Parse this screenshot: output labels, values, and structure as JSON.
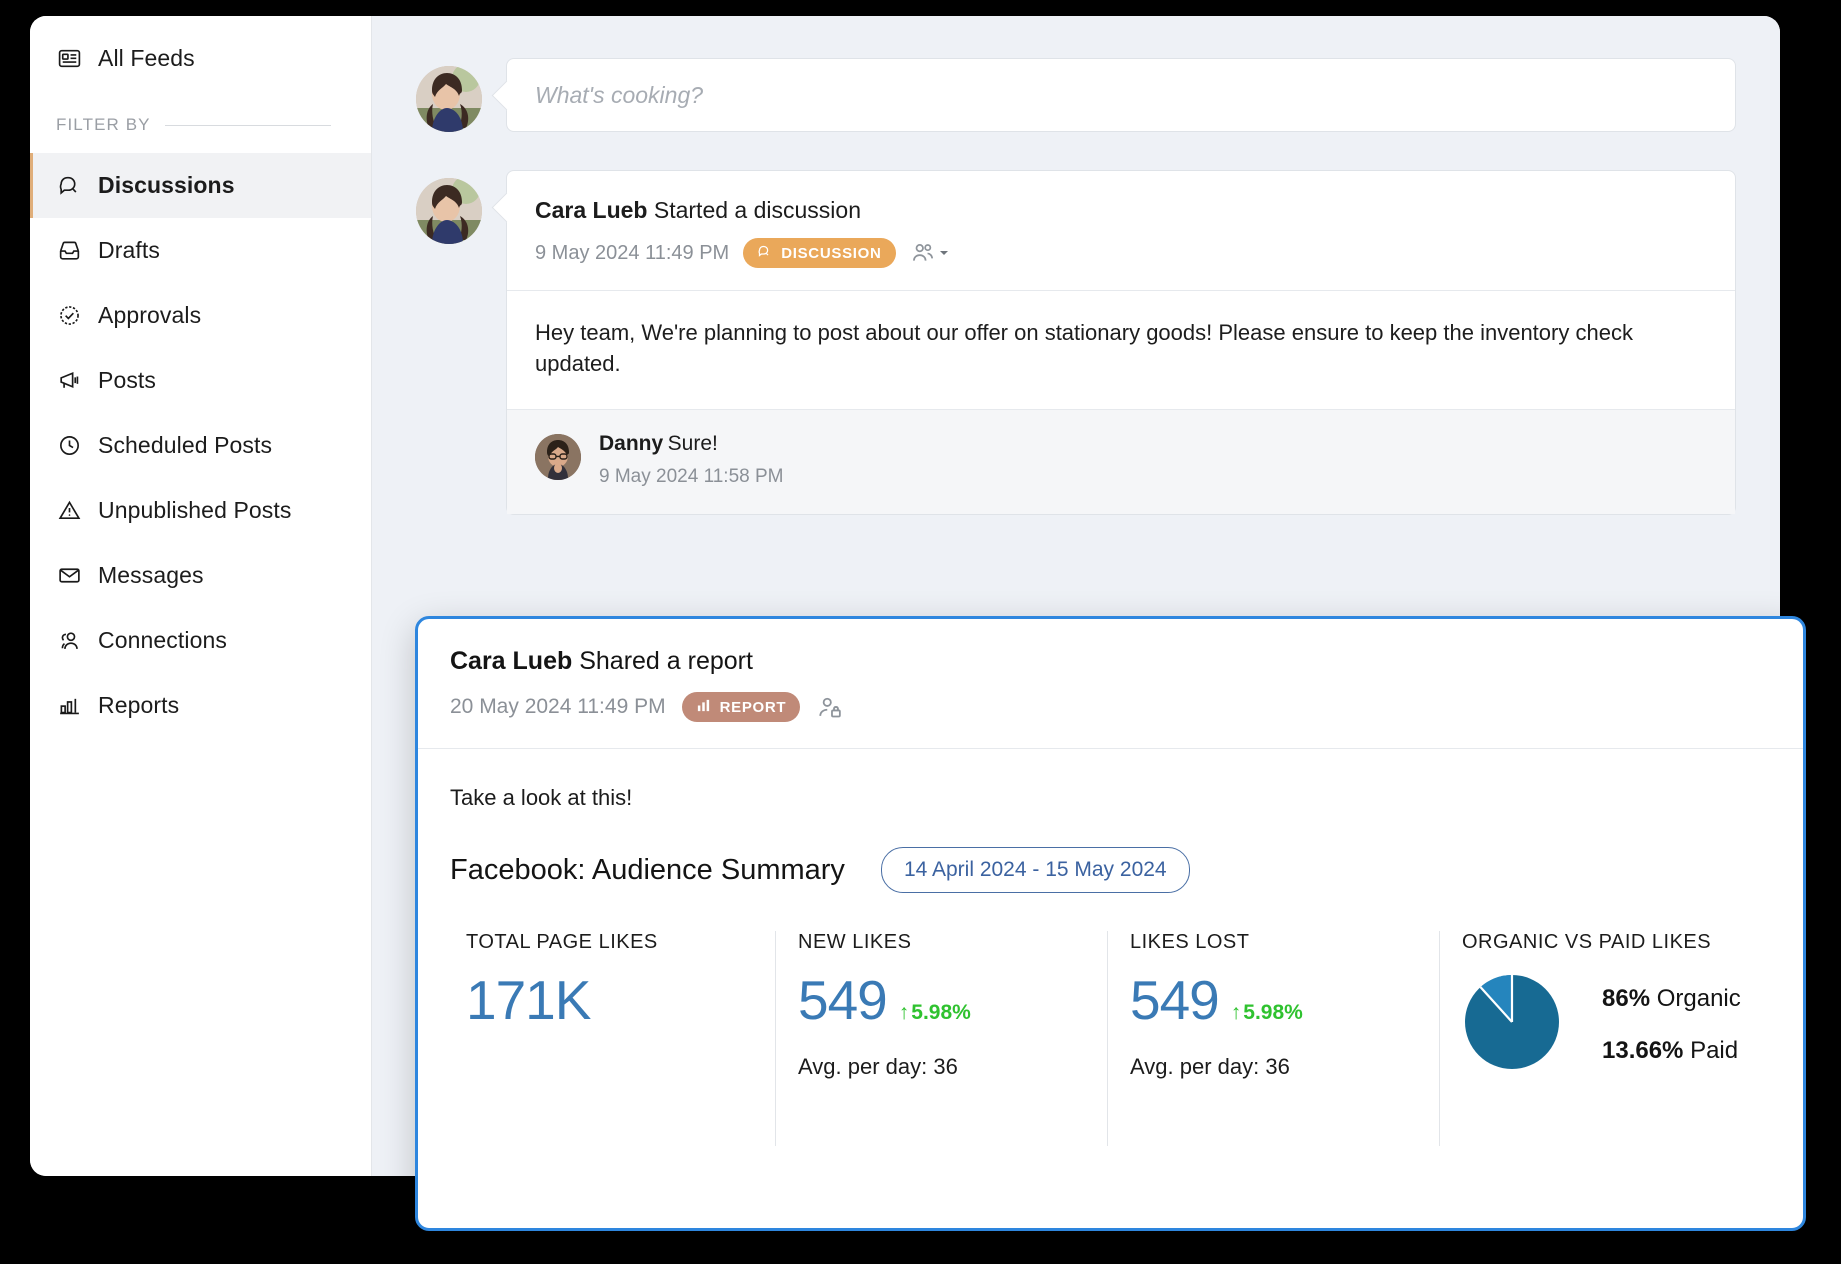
{
  "sidebar": {
    "top_item": {
      "label": "All Feeds",
      "icon": "feed-icon"
    },
    "filter_label": "FILTER BY",
    "items": [
      {
        "label": "Discussions",
        "icon": "chat-icon",
        "active": true
      },
      {
        "label": "Drafts",
        "icon": "drafts-tray-icon",
        "active": false
      },
      {
        "label": "Approvals",
        "icon": "check-badge-icon",
        "active": false
      },
      {
        "label": "Posts",
        "icon": "megaphone-icon",
        "active": false
      },
      {
        "label": "Scheduled Posts",
        "icon": "clock-icon",
        "active": false
      },
      {
        "label": "Unpublished Posts",
        "icon": "warning-triangle-icon",
        "active": false
      },
      {
        "label": "Messages",
        "icon": "envelope-icon",
        "active": false
      },
      {
        "label": "Connections",
        "icon": "people-icon",
        "active": false
      },
      {
        "label": "Reports",
        "icon": "bar-chart-icon",
        "active": false
      }
    ]
  },
  "composer": {
    "placeholder": "What's cooking?"
  },
  "discussion_post": {
    "author": "Cara Lueb",
    "action": "Started a discussion",
    "date": "9 May 2024 11:49 PM",
    "badge": "DISCUSSION",
    "badge_color": "#eaa85a",
    "audience_icon": "audience-people-icon",
    "body": "Hey team, We're planning to post about our offer on stationary goods! Please ensure to keep the inventory check updated.",
    "reply": {
      "author": "Danny",
      "text": "Sure!",
      "date": "9 May 2024 11:58 PM"
    }
  },
  "report_card": {
    "author": "Cara Lueb",
    "action": "Shared a report",
    "date": "20 May 2024 11:49 PM",
    "badge": "REPORT",
    "badge_color": "#c08a78",
    "audience_icon": "private-person-icon",
    "note": "Take a look at this!",
    "subtitle": "Facebook: Audience Summary",
    "date_range": "14 April 2024 - 15 May 2024",
    "accent_color": "#2e86de",
    "metrics": [
      {
        "label": "TOTAL PAGE LIKES",
        "value": "171K",
        "delta": "",
        "sub": ""
      },
      {
        "label": "NEW LIKES",
        "value": "549",
        "delta": "5.98%",
        "sub": "Avg. per day: 36"
      },
      {
        "label": "LIKES LOST",
        "value": "549",
        "delta": "5.98%",
        "sub": "Avg. per day: 36"
      }
    ],
    "pie_label": "ORGANIC VS PAID LIKES",
    "legend": [
      {
        "value": "86%",
        "name": "Organic"
      },
      {
        "value": "13.66%",
        "name": "Paid"
      }
    ]
  },
  "chart_data": {
    "type": "pie",
    "title": "ORGANIC VS PAID LIKES",
    "categories": [
      "Organic",
      "Paid"
    ],
    "values": [
      86,
      13.66
    ],
    "labels": [
      "86% Organic",
      "13.66% Paid"
    ],
    "colors": [
      "#176a93",
      "#2585bd"
    ],
    "legend_position": "right"
  }
}
